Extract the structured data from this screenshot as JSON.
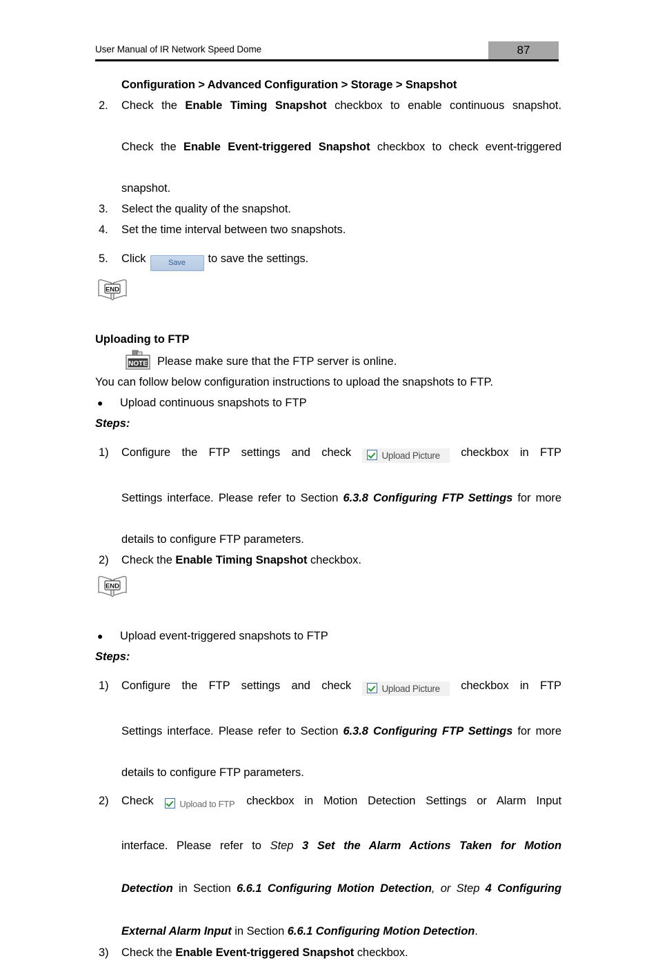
{
  "header": {
    "title": "User Manual of IR Network Speed Dome",
    "page_number": "87",
    "page_box_color": "#a6a6a6"
  },
  "breadcrumb": "Configuration > Advanced Configuration > Storage > Snapshot",
  "steps_top": [
    {
      "marker": "2.",
      "line1_a": "Check the ",
      "line1_b": "Enable Timing Snapshot",
      "line1_c": " checkbox to enable continuous snapshot.",
      "line2_a": "Check the ",
      "line2_b": "Enable Event-triggered Snapshot",
      "line2_c": " checkbox to check event-triggered",
      "line3": "snapshot."
    },
    {
      "marker": "3.",
      "text": "Select the quality of the snapshot."
    },
    {
      "marker": "4.",
      "text": "Set the time interval between two snapshots."
    },
    {
      "marker": "5.",
      "text_before": "Click",
      "button_label": "Save",
      "text_after": "to save the settings."
    }
  ],
  "end_icon_label": "END",
  "note_icon_label": "NOTE",
  "ftp_section": {
    "heading": "Uploading to FTP",
    "note_text": "Please make sure that the FTP server is online.",
    "intro": "You can follow below configuration instructions to upload the snapshots to FTP.",
    "bullet_dot": "●",
    "bullet1": "Upload continuous snapshots to FTP",
    "steps_label": "Steps:",
    "s1": {
      "marker": "1)",
      "a": "Configure the FTP settings and check",
      "chip_label": "Upload Picture",
      "b": "checkbox in FTP",
      "line2_a": "Settings interface. Please refer to Section ",
      "line2_b": "6.3.8 Configuring FTP Settings",
      "line2_c": " for more",
      "line3": "details to configure FTP parameters."
    },
    "s2": {
      "marker": "2)",
      "a": "Check the ",
      "b": "Enable Timing Snapshot",
      "c": " checkbox."
    }
  },
  "ftp_event_section": {
    "bullet_dot": "●",
    "bullet1": "Upload event-triggered snapshots to FTP",
    "steps_label": "Steps:",
    "s1": {
      "marker": "1)",
      "a": "Configure the FTP settings and check",
      "chip_label": "Upload Picture",
      "b": "checkbox in FTP",
      "line2_a": "Settings interface. Please refer to Section ",
      "line2_b": "6.3.8 Configuring FTP Settings",
      "line2_c": " for more",
      "line3": "details to configure FTP parameters."
    },
    "s2": {
      "marker": "2)",
      "a": "Check",
      "chip_label": "Upload to FTP",
      "b": "checkbox in Motion Detection Settings or Alarm Input",
      "line2_a": "interface. Please refer to ",
      "line2_b": "Step",
      "line2_c": " 3 Set the Alarm Actions Taken for Motion",
      "line3_a": "Detection",
      "line3_b": " in Section ",
      "line3_c": "6.6.1 Configuring Motion Detection",
      "line3_d": ", or ",
      "line3_e": "Step",
      "line3_f": " 4 Configuring",
      "line4_a": "External Alarm Input",
      "line4_b": " in Section ",
      "line4_c": "6.6.1 Configuring Motion Detection",
      "line4_d": "."
    },
    "s3": {
      "marker": "3)",
      "a": "Check the ",
      "b": "Enable Event-triggered Snapshot",
      "c": " checkbox."
    }
  }
}
